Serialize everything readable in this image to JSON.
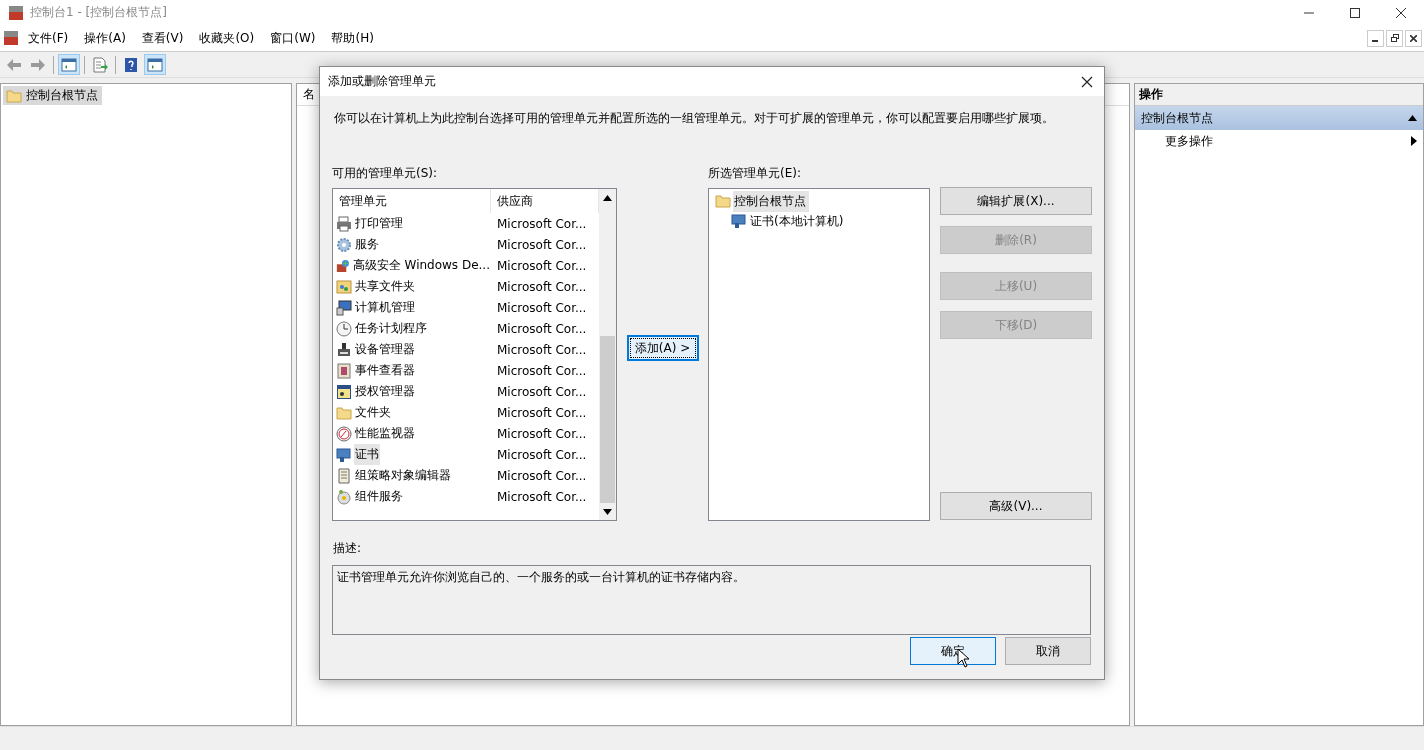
{
  "window": {
    "title": "控制台1 - [控制台根节点]"
  },
  "menu": [
    "文件(F)",
    "操作(A)",
    "查看(V)",
    "收藏夹(O)",
    "窗口(W)",
    "帮助(H)"
  ],
  "toolbar": [
    {
      "pressed": false
    },
    {
      "pressed": false
    },
    {
      "pressed": true
    },
    {
      "pressed": false
    },
    {
      "pressed": false
    },
    {
      "pressed": true
    }
  ],
  "tree": {
    "items": [
      {
        "label": "控制台根节点",
        "selected": true
      }
    ]
  },
  "middle_pane": {
    "column_1": "名"
  },
  "actions_pane": {
    "title": "操作",
    "section": "控制台根节点",
    "expanded": true,
    "items": [
      {
        "label": "更多操作"
      }
    ]
  },
  "dialog": {
    "title": "添加或删除管理单元",
    "intro": "你可以在计算机上为此控制台选择可用的管理单元并配置所选的一组管理单元。对于可扩展的管理单元，你可以配置要启用哪些扩展项。",
    "available": {
      "label": "可用的管理单元(S):",
      "columns": [
        "管理单元",
        "供应商"
      ],
      "rows": [
        {
          "name": "打印管理",
          "vendor": "Microsoft Cor...",
          "selected": false
        },
        {
          "name": "服务",
          "vendor": "Microsoft Cor...",
          "selected": false
        },
        {
          "name": "高级安全 Windows De...",
          "vendor": "Microsoft Cor...",
          "selected": false
        },
        {
          "name": "共享文件夹",
          "vendor": "Microsoft Cor...",
          "selected": false
        },
        {
          "name": "计算机管理",
          "vendor": "Microsoft Cor...",
          "selected": false
        },
        {
          "name": "任务计划程序",
          "vendor": "Microsoft Cor...",
          "selected": false
        },
        {
          "name": "设备管理器",
          "vendor": "Microsoft Cor...",
          "selected": false
        },
        {
          "name": "事件查看器",
          "vendor": "Microsoft Cor...",
          "selected": false
        },
        {
          "name": "授权管理器",
          "vendor": "Microsoft Cor...",
          "selected": false
        },
        {
          "name": "文件夹",
          "vendor": "Microsoft Cor...",
          "selected": false
        },
        {
          "name": "性能监视器",
          "vendor": "Microsoft Cor...",
          "selected": false
        },
        {
          "name": "证书",
          "vendor": "Microsoft Cor...",
          "selected": true
        },
        {
          "name": "组策略对象编辑器",
          "vendor": "Microsoft Cor...",
          "selected": false
        },
        {
          "name": "组件服务",
          "vendor": "Microsoft Cor...",
          "selected": false
        }
      ]
    },
    "add_button": "添加(A) >",
    "selected_snapins": {
      "label": "所选管理单元(E):",
      "tree": [
        {
          "label": "控制台根节点",
          "selected": true,
          "children": [
            {
              "label": "证书(本地计算机)",
              "selected": false
            }
          ]
        }
      ]
    },
    "side_groups": [
      {
        "buttons": [
          {
            "label": "编辑扩展(X)...",
            "disabled": false
          },
          {
            "label": "删除(R)",
            "disabled": true
          }
        ]
      },
      {
        "buttons": [
          {
            "label": "上移(U)",
            "disabled": true
          },
          {
            "label": "下移(D)",
            "disabled": true
          }
        ]
      },
      {
        "buttons": [
          {
            "label": "高级(V)...",
            "disabled": false
          }
        ]
      }
    ],
    "description": {
      "label": "描述:",
      "text": "证书管理单元允许你浏览自己的、一个服务的或一台计算机的证书存储内容。"
    },
    "buttons": [
      {
        "label": "确定",
        "default": true
      },
      {
        "label": "取消",
        "default": false
      }
    ]
  }
}
